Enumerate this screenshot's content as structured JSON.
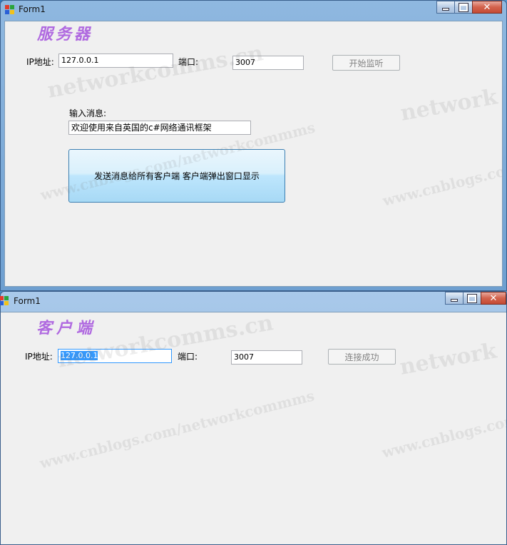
{
  "server_window": {
    "title": "Form1",
    "heading": "服务器",
    "ip_label": "IP地址:",
    "ip_value": "127.0.0.1",
    "port_label": "端口:",
    "port_value": "3007",
    "listen_button": "开始监听",
    "message_label": "输入消息:",
    "message_value": "欢迎使用来自英国的c#网络通讯框架",
    "send_button": "发送消息给所有客户端 客户端弹出窗口显示"
  },
  "client_window": {
    "title": "Form1",
    "heading": "客户端",
    "ip_label": "IP地址:",
    "ip_value": "127.0.0.1",
    "port_label": "端口:",
    "port_value": "3007",
    "connect_button": "连接成功"
  },
  "window_controls": {
    "minimize": "minimize-icon",
    "maximize": "maximize-icon",
    "close": "close-icon"
  },
  "watermarks": {
    "networkcomms": "networkcomms.cn",
    "cnblogs": "www.cnblogs.com/networkcommms",
    "cnblogs_short": "www.cnblogs.com",
    "network": "network"
  },
  "colors": {
    "heading": "#b06ae0",
    "selection": "#3399ff"
  }
}
